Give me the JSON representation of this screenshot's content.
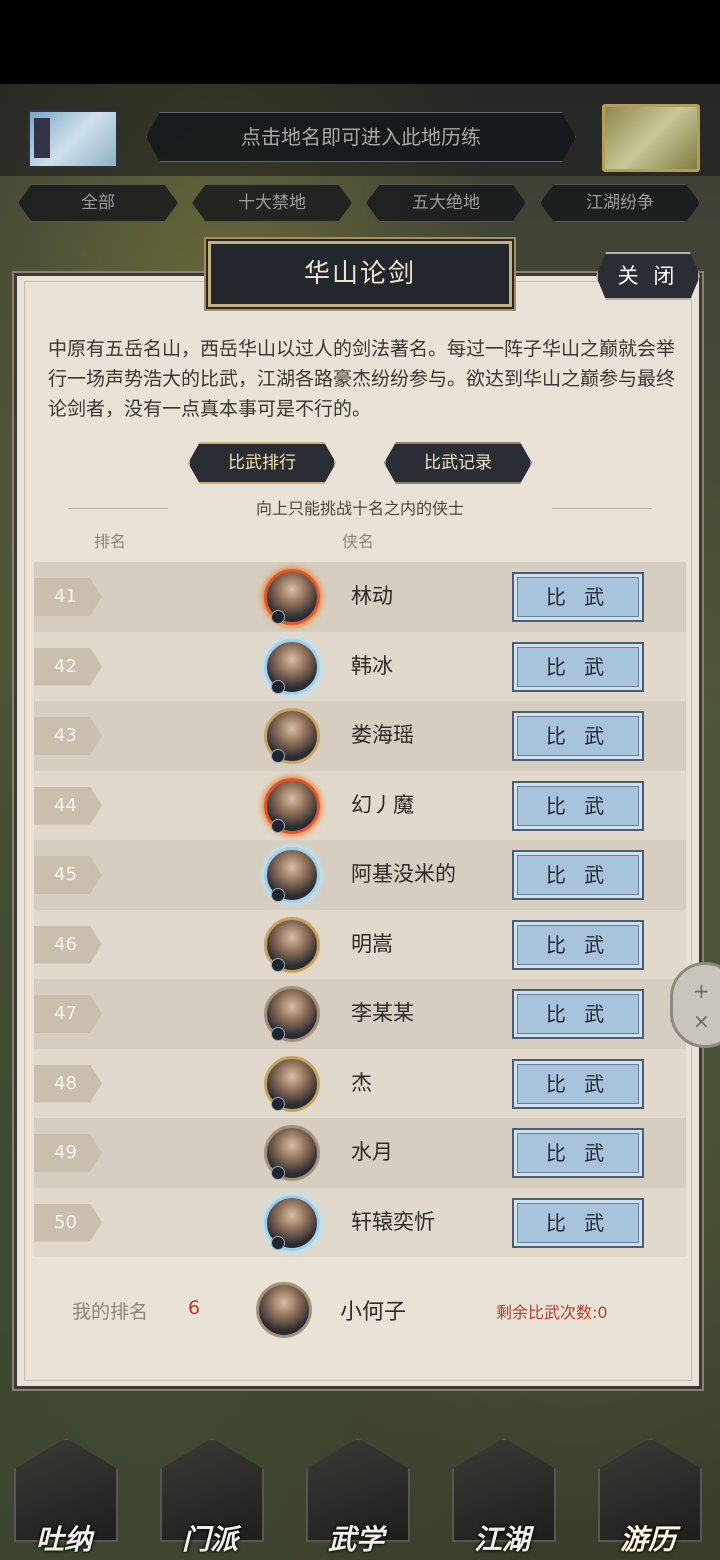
{
  "map": {
    "hint": "点击地名即可进入此地历练",
    "tabs": [
      "全部",
      "十大禁地",
      "五大绝地",
      "江湖纷争"
    ]
  },
  "dialog": {
    "title": "华山论剑",
    "close_label": "关 闭",
    "description": "中原有五岳名山，西岳华山以过人的剑法著名。每过一阵子华山之巅就会举行一场声势浩大的比武，江湖各路豪杰纷纷参与。欲达到华山之巅参与最终论剑者，没有一点真本事可是不行的。",
    "subtabs": {
      "ranking": "比武排行",
      "records": "比武记录",
      "active": "ranking"
    },
    "hint": "向上只能挑战十名之内的侠士",
    "headers": {
      "rank": "排名",
      "name": "侠名"
    },
    "fight_label": "比 武",
    "rows": [
      {
        "rank": "41",
        "name": "林动",
        "frame": "fire"
      },
      {
        "rank": "42",
        "name": "韩冰",
        "frame": "ice"
      },
      {
        "rank": "43",
        "name": "娄海瑶",
        "frame": "gold"
      },
      {
        "rank": "44",
        "name": "幻丿魔",
        "frame": "fire"
      },
      {
        "rank": "45",
        "name": "阿基没米的",
        "frame": "ice"
      },
      {
        "rank": "46",
        "name": "明嵩",
        "frame": "gold"
      },
      {
        "rank": "47",
        "name": "李某某",
        "frame": "plain"
      },
      {
        "rank": "48",
        "name": "杰",
        "frame": "gold"
      },
      {
        "rank": "49",
        "name": "水月",
        "frame": "plain"
      },
      {
        "rank": "50",
        "name": "轩辕奕忻",
        "frame": "ice"
      }
    ],
    "mine": {
      "label": "我的排名",
      "rank": "6",
      "name": "小何子",
      "remaining": "剩余比武次数:0"
    }
  },
  "side_wheel": {
    "plus": "+",
    "close": "×"
  },
  "nav": [
    "吐纳",
    "门派",
    "武学",
    "江湖",
    "游历"
  ],
  "nav_active": "游历"
}
